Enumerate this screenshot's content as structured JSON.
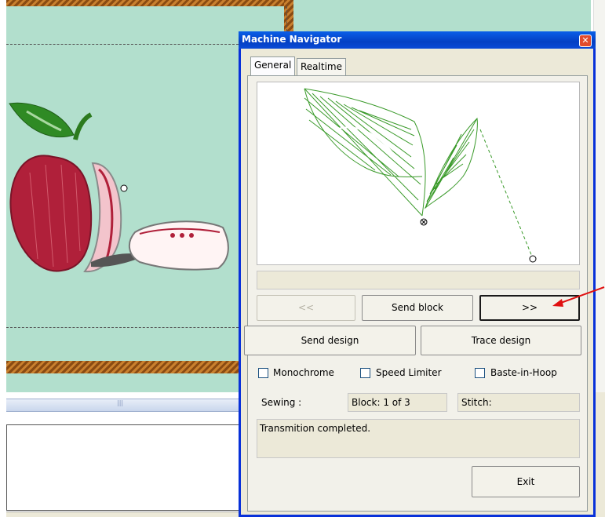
{
  "dialog": {
    "title": "Machine Navigator",
    "close_glyph": "✕",
    "tabs": [
      {
        "label": "General",
        "active": true
      },
      {
        "label": "Realtime",
        "active": false
      }
    ],
    "buttons": {
      "prev": "<<",
      "send_block": "Send block",
      "next": ">>",
      "send_design": "Send design",
      "trace_design": "Trace design",
      "exit": "Exit"
    },
    "checkboxes": [
      {
        "label": "Monochrome",
        "checked": false
      },
      {
        "label": "Speed Limiter",
        "checked": false
      },
      {
        "label": "Baste-in-Hoop",
        "checked": false
      }
    ],
    "sewing_label": "Sewing :",
    "block_field": "Block: 1 of 3",
    "stitch_field": "Stitch:",
    "status_message": "Transmition completed."
  },
  "workspace": {
    "hscroll_grip": "|||"
  },
  "colors": {
    "hoop": "#b2dfcd",
    "title_bar": "#0440c4",
    "dialog_bg": "#ece9d8",
    "stitch_green": "#3a9a2a",
    "apple_red": "#b0203a",
    "annotation_arrow": "#e01010"
  }
}
